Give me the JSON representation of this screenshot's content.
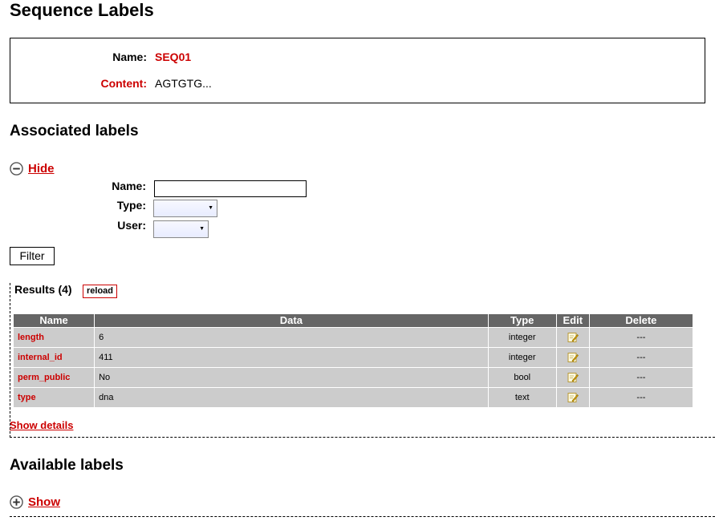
{
  "page": {
    "title": "Sequence Labels"
  },
  "sequence": {
    "name_label": "Name:",
    "name_value": "SEQ01",
    "content_label": "Content:",
    "content_value": "AGTGTG..."
  },
  "associated": {
    "heading": "Associated labels",
    "toggle_label": "Hide",
    "filter": {
      "name_label": "Name:",
      "type_label": "Type:",
      "user_label": "User:",
      "name_value": "",
      "type_value": "",
      "user_value": "",
      "button_label": "Filter"
    },
    "results_label": "Results (4)",
    "reload_label": "reload",
    "columns": [
      "Name",
      "Data",
      "Type",
      "Edit",
      "Delete"
    ],
    "rows": [
      {
        "name": "length",
        "data": "6",
        "type": "integer",
        "delete": "---"
      },
      {
        "name": "internal_id",
        "data": "411",
        "type": "integer",
        "delete": "---"
      },
      {
        "name": "perm_public",
        "data": "No",
        "type": "bool",
        "delete": "---"
      },
      {
        "name": "type",
        "data": "dna",
        "type": "text",
        "delete": "---"
      }
    ],
    "show_details_label": "Show details"
  },
  "available": {
    "heading": "Available labels",
    "toggle_label": "Show"
  },
  "colors": {
    "accent": "#cc0000",
    "table_header": "#666666",
    "table_cell": "#cccccc"
  },
  "icons": {
    "collapse": "minus-circle-icon",
    "expand": "plus-circle-icon",
    "edit": "edit-pencil-icon"
  }
}
